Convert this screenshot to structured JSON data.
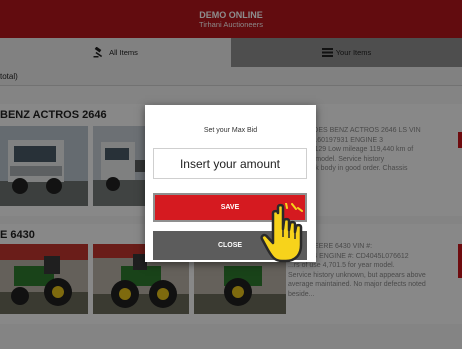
{
  "header": {
    "title": "DEMO ONLINE",
    "subtitle": "Tirhani Auctioneers",
    "background": "#b3161c"
  },
  "tabs": [
    {
      "label": "All Items",
      "icon": "gavel-icon",
      "active": true
    },
    {
      "label": "Your Items",
      "icon": "list-icon",
      "active": false
    }
  ],
  "total_text": "total)",
  "lots": [
    {
      "title": "BENZ ACTROS 2646",
      "description_lines": [
        "MERCEDES BENZ ACTROS 2646 LS VIN",
        "...93424160197931 ENGINE 3",
        "...C1022129 Low mileage 119,440 km of",
        "the year model. Service history",
        "...n. Truck body in good order. Chassis",
        "..."
      ]
    },
    {
      "title": "E 6430",
      "description_lines": [
        "JOHN DEERE 6430 VIN #:",
        "...591924 ENGINE #: CD4045L076612",
        "...rs of use 4,701.5 for year model.",
        "Service history unknown, but appears above",
        "average maintained. No major defects noted",
        "beside..."
      ]
    }
  ],
  "modal": {
    "title": "Set your Max Bid",
    "input_placeholder": "Insert your amount",
    "save_label": "SAVE",
    "close_label": "CLOSE",
    "save_color": "#d51a20",
    "close_color": "#5c5c5c"
  },
  "cursor_icon": "hand-pointer-icon"
}
